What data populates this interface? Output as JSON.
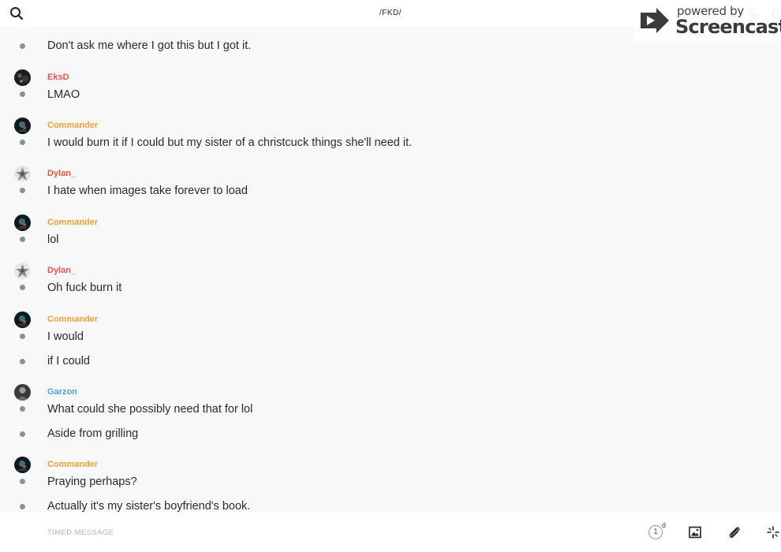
{
  "header": {
    "title": "/FKD/",
    "icons": [
      "search-icon",
      "phone-icon",
      "info-icon"
    ]
  },
  "watermark": {
    "powered": "powered by",
    "brand": "Screencastify"
  },
  "colors": {
    "EksD": "#e0554c",
    "Commander": "#f0a03a",
    "Dylan_": "#e0554c",
    "Garzon": "#4aa3d6",
    "dot": "#8a8f96"
  },
  "messages": [
    {
      "text": "Don't ask me where I got this but I got it."
    },
    {
      "user": "EksD",
      "text": "LMAO"
    },
    {
      "user": "Commander",
      "text": "I would burn it if I could but my sister of a christcuck things she'll need it."
    },
    {
      "user": "Dylan_",
      "text": "I hate when images take forever to load"
    },
    {
      "user": "Commander",
      "text": "lol"
    },
    {
      "user": "Dylan_",
      "text": "Oh fuck burn it"
    },
    {
      "user": "Commander",
      "text": "I would"
    },
    {
      "text": "if I could"
    },
    {
      "user": "Garzon",
      "text": "What could she possibly need that for lol"
    },
    {
      "text": "Aside from grilling"
    },
    {
      "user": "Commander",
      "text": "Praying perhaps?"
    },
    {
      "text": "Actually it's my sister's boyfriend's book."
    }
  ],
  "composer": {
    "placeholder": "TIMED MESSAGE",
    "timer_value": "1",
    "timer_unit": "d",
    "icons": [
      "timer-icon",
      "image-icon",
      "paperclip-icon",
      "sparkle-icon"
    ]
  }
}
